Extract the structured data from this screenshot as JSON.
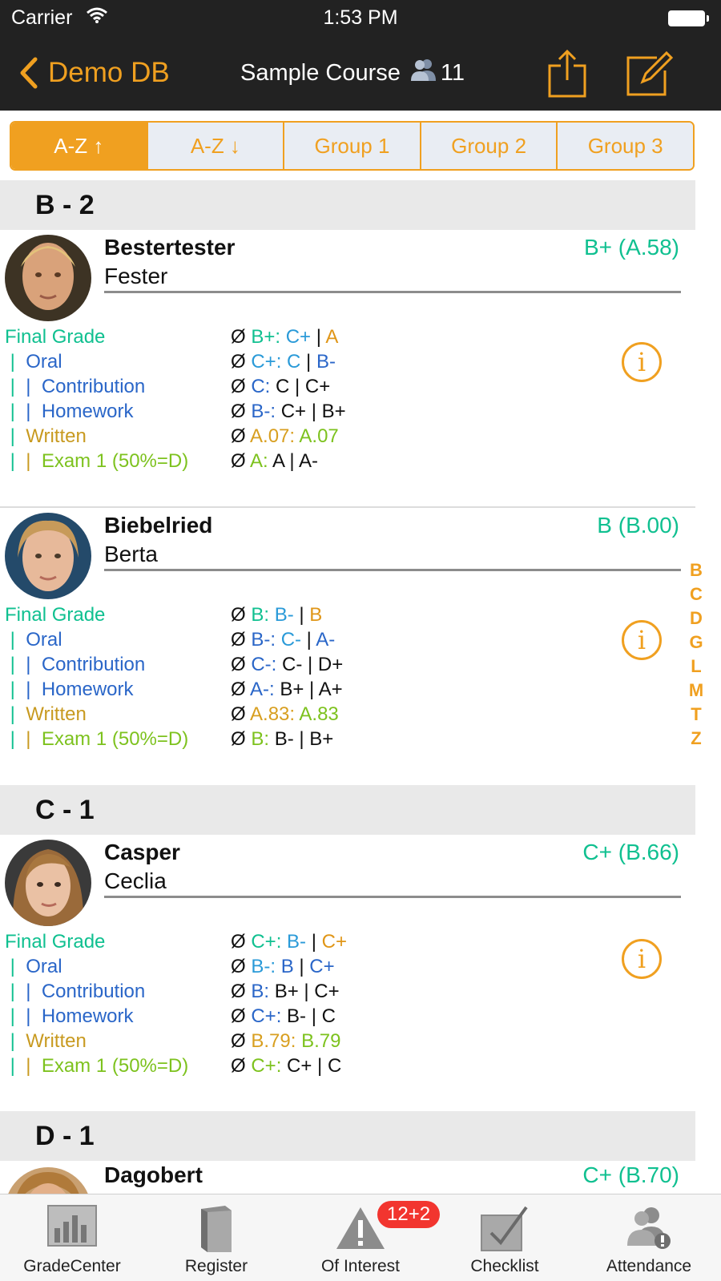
{
  "status_bar": {
    "carrier": "Carrier",
    "time": "1:53 PM"
  },
  "nav": {
    "back_label": "Demo DB",
    "title": "Sample Course",
    "student_count": "11"
  },
  "segments": [
    "A-Z ↑",
    "A-Z ↓",
    "Group 1",
    "Group 2",
    "Group 3"
  ],
  "sections": [
    {
      "label": "B - 2"
    },
    {
      "label": "C - 1"
    },
    {
      "label": "D - 1"
    }
  ],
  "students": [
    {
      "last": "Bestertester",
      "first": "Fester",
      "grade": "B+ (A.58)",
      "rows": [
        {
          "label": "Final Grade",
          "prefix": "",
          "value": [
            {
              "t": "Ø ",
              "c": "c-black"
            },
            {
              "t": "B+: ",
              "c": "c-green"
            },
            {
              "t": "C+",
              "c": "c-blue2"
            },
            {
              "t": " | ",
              "c": "c-black"
            },
            {
              "t": "A",
              "c": "c-orange"
            }
          ]
        },
        {
          "label": "Oral",
          "prefix": "| ",
          "value": [
            {
              "t": "Ø ",
              "c": "c-black"
            },
            {
              "t": "C+: ",
              "c": "c-blue2"
            },
            {
              "t": "C",
              "c": "c-blue2"
            },
            {
              "t": " | ",
              "c": "c-black"
            },
            {
              "t": "B-",
              "c": "c-oral"
            }
          ]
        },
        {
          "label": "Contribution",
          "prefix": "|  | ",
          "value": [
            {
              "t": "Ø ",
              "c": "c-black"
            },
            {
              "t": "C: ",
              "c": "c-oral"
            },
            {
              "t": "C | C+",
              "c": "c-black"
            }
          ]
        },
        {
          "label": "Homework",
          "prefix": "|  | ",
          "value": [
            {
              "t": "Ø ",
              "c": "c-black"
            },
            {
              "t": "B-: ",
              "c": "c-oral"
            },
            {
              "t": "C+ | B+",
              "c": "c-black"
            }
          ]
        },
        {
          "label": "Written",
          "prefix": "| ",
          "value": [
            {
              "t": "Ø ",
              "c": "c-black"
            },
            {
              "t": "A.07: ",
              "c": "c-gold"
            },
            {
              "t": "A.07",
              "c": "c-lime"
            }
          ]
        },
        {
          "label": "Exam 1 (50%=D)",
          "prefix": "|  | ",
          "value": [
            {
              "t": "Ø ",
              "c": "c-black"
            },
            {
              "t": "A: ",
              "c": "c-lime"
            },
            {
              "t": "A | A-",
              "c": "c-black"
            }
          ]
        }
      ]
    },
    {
      "last": "Biebelried",
      "first": "Berta",
      "grade": "B (B.00)",
      "rows": [
        {
          "label": "Final Grade",
          "prefix": "",
          "value": [
            {
              "t": "Ø ",
              "c": "c-black"
            },
            {
              "t": "B: ",
              "c": "c-green"
            },
            {
              "t": "B-",
              "c": "c-blue2"
            },
            {
              "t": " | ",
              "c": "c-black"
            },
            {
              "t": "B",
              "c": "c-orange"
            }
          ]
        },
        {
          "label": "Oral",
          "prefix": "| ",
          "value": [
            {
              "t": "Ø ",
              "c": "c-black"
            },
            {
              "t": "B-: ",
              "c": "c-oral"
            },
            {
              "t": "C-",
              "c": "c-blue2"
            },
            {
              "t": " | ",
              "c": "c-black"
            },
            {
              "t": "A-",
              "c": "c-oral"
            }
          ]
        },
        {
          "label": "Contribution",
          "prefix": "|  | ",
          "value": [
            {
              "t": "Ø ",
              "c": "c-black"
            },
            {
              "t": "C-: ",
              "c": "c-oral"
            },
            {
              "t": "C- | D+",
              "c": "c-black"
            }
          ]
        },
        {
          "label": "Homework",
          "prefix": "|  | ",
          "value": [
            {
              "t": "Ø ",
              "c": "c-black"
            },
            {
              "t": "A-: ",
              "c": "c-oral"
            },
            {
              "t": "B+ | A+",
              "c": "c-black"
            }
          ]
        },
        {
          "label": "Written",
          "prefix": "| ",
          "value": [
            {
              "t": "Ø ",
              "c": "c-black"
            },
            {
              "t": "A.83: ",
              "c": "c-gold"
            },
            {
              "t": "A.83",
              "c": "c-lime"
            }
          ]
        },
        {
          "label": "Exam 1 (50%=D)",
          "prefix": "|  | ",
          "value": [
            {
              "t": "Ø ",
              "c": "c-black"
            },
            {
              "t": "B: ",
              "c": "c-lime"
            },
            {
              "t": "B- | B+",
              "c": "c-black"
            }
          ]
        }
      ]
    },
    {
      "last": "Casper",
      "first": "Ceclia",
      "grade": "C+ (B.66)",
      "rows": [
        {
          "label": "Final Grade",
          "prefix": "",
          "value": [
            {
              "t": "Ø ",
              "c": "c-black"
            },
            {
              "t": "C+: ",
              "c": "c-green"
            },
            {
              "t": "B-",
              "c": "c-blue2"
            },
            {
              "t": " | ",
              "c": "c-black"
            },
            {
              "t": "C+",
              "c": "c-orange"
            }
          ]
        },
        {
          "label": "Oral",
          "prefix": "| ",
          "value": [
            {
              "t": "Ø ",
              "c": "c-black"
            },
            {
              "t": "B-: ",
              "c": "c-blue2"
            },
            {
              "t": "B",
              "c": "c-oral"
            },
            {
              "t": " | ",
              "c": "c-black"
            },
            {
              "t": "C+",
              "c": "c-oral"
            }
          ]
        },
        {
          "label": "Contribution",
          "prefix": "|  | ",
          "value": [
            {
              "t": "Ø ",
              "c": "c-black"
            },
            {
              "t": "B: ",
              "c": "c-oral"
            },
            {
              "t": "B+ | C+",
              "c": "c-black"
            }
          ]
        },
        {
          "label": "Homework",
          "prefix": "|  | ",
          "value": [
            {
              "t": "Ø ",
              "c": "c-black"
            },
            {
              "t": "C+: ",
              "c": "c-oral"
            },
            {
              "t": "B- | C",
              "c": "c-black"
            }
          ]
        },
        {
          "label": "Written",
          "prefix": "| ",
          "value": [
            {
              "t": "Ø ",
              "c": "c-black"
            },
            {
              "t": "B.79: ",
              "c": "c-gold"
            },
            {
              "t": "B.79",
              "c": "c-lime"
            }
          ]
        },
        {
          "label": "Exam 1 (50%=D)",
          "prefix": "|  | ",
          "value": [
            {
              "t": "Ø ",
              "c": "c-black"
            },
            {
              "t": "C+: ",
              "c": "c-lime"
            },
            {
              "t": "C+ | C",
              "c": "c-black"
            }
          ]
        }
      ]
    },
    {
      "last": "Dagobert",
      "first": "",
      "grade": "C+ (B.70)",
      "rows": []
    }
  ],
  "index_letters": [
    "B",
    "C",
    "D",
    "G",
    "L",
    "M",
    "T",
    "Z"
  ],
  "tabs": [
    {
      "label": "GradeCenter",
      "icon": "bar-chart-icon"
    },
    {
      "label": "Register",
      "icon": "book-icon"
    },
    {
      "label": "Of Interest",
      "icon": "warning-icon",
      "badge": "12+2"
    },
    {
      "label": "Checklist",
      "icon": "checkbox-icon"
    },
    {
      "label": "Attendance",
      "icon": "attendance-icon"
    }
  ],
  "colors": {
    "accent": "#f0a020",
    "dark_bar": "#222222",
    "grade_green": "#10c090",
    "badge_red": "#f2352f"
  }
}
